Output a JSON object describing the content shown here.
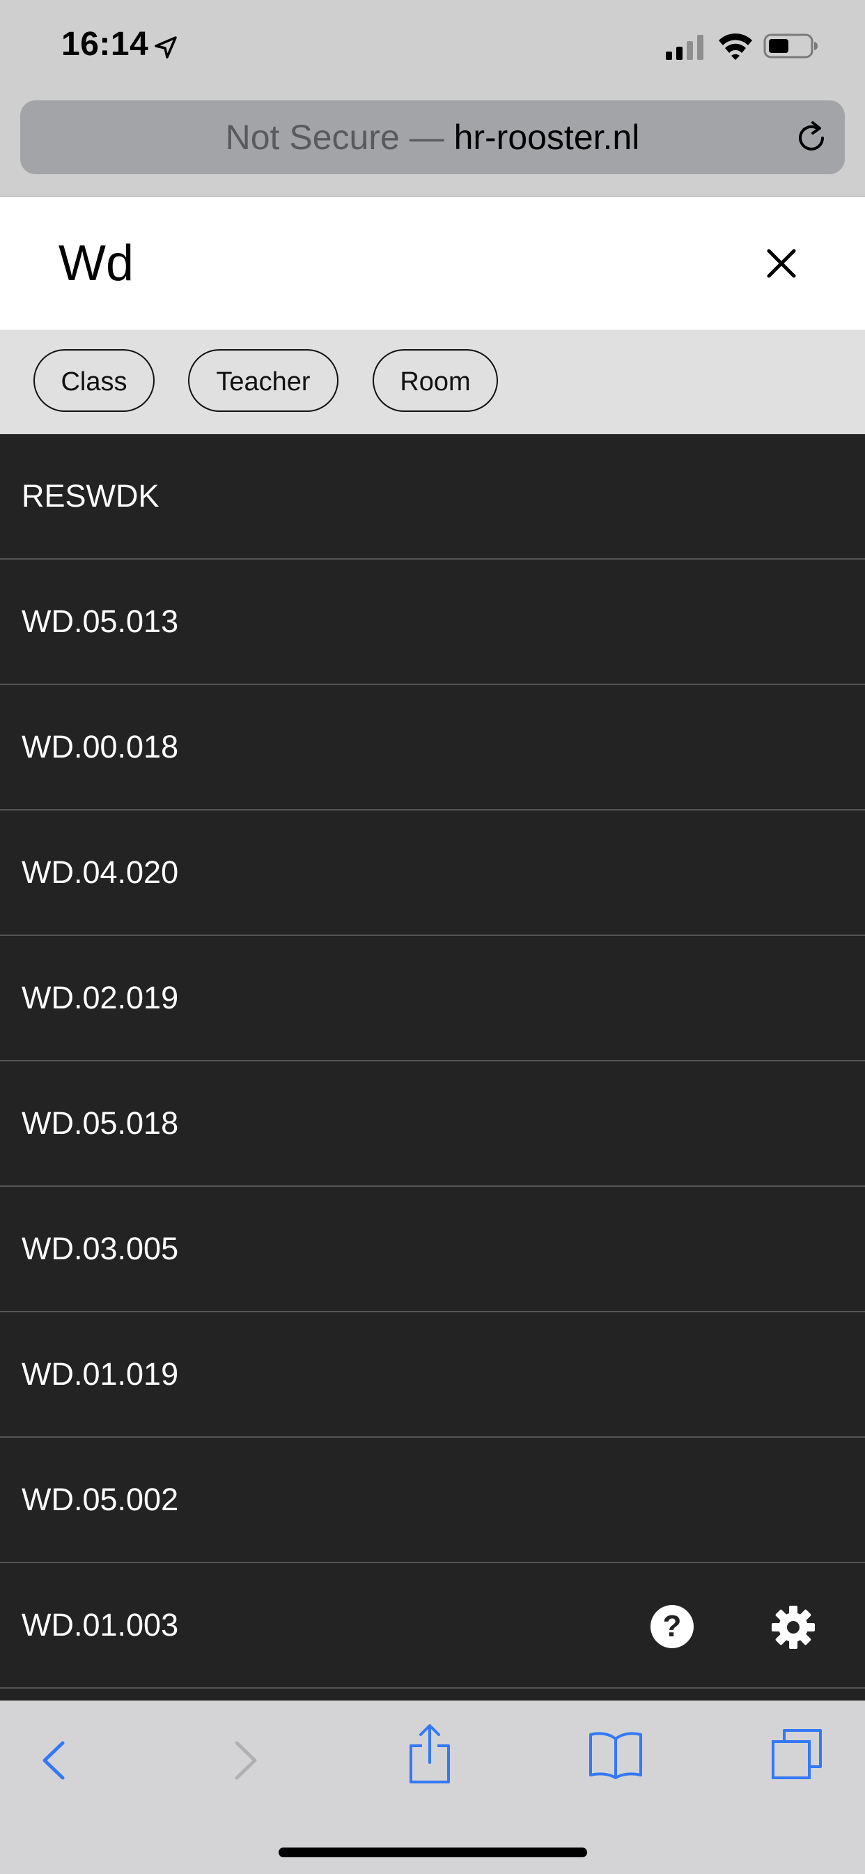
{
  "status_bar": {
    "time": "16:14",
    "location_icon": "location-arrow-icon",
    "signal_icon": "cellular-signal-icon",
    "wifi_icon": "wifi-icon",
    "battery_icon": "battery-icon"
  },
  "browser": {
    "security_label": "Not Secure",
    "separator": " — ",
    "domain": "hr-rooster.nl",
    "reload_icon": "reload-icon"
  },
  "search": {
    "value": "Wd",
    "close_icon": "close-icon"
  },
  "filters": [
    {
      "label": "Class"
    },
    {
      "label": "Teacher"
    },
    {
      "label": "Room"
    }
  ],
  "results": [
    {
      "label": "RESWDK"
    },
    {
      "label": "WD.05.013"
    },
    {
      "label": "WD.00.018"
    },
    {
      "label": "WD.04.020"
    },
    {
      "label": "WD.02.019"
    },
    {
      "label": "WD.05.018"
    },
    {
      "label": "WD.03.005"
    },
    {
      "label": "WD.01.019"
    },
    {
      "label": "WD.05.002"
    },
    {
      "label": "WD.01.003"
    }
  ],
  "floating": {
    "help_symbol": "?",
    "help_icon": "help-icon",
    "settings_icon": "gear-icon"
  },
  "toolbar": {
    "icons": [
      "back-icon",
      "forward-icon",
      "share-icon",
      "bookmarks-icon",
      "tabs-icon"
    ]
  },
  "colors": {
    "list_background": "#232323",
    "list_divider": "#555555",
    "filter_background": "#e0e0e0",
    "url_bar": "#a3a4a7",
    "toolbar_accent": "#3478f6"
  }
}
